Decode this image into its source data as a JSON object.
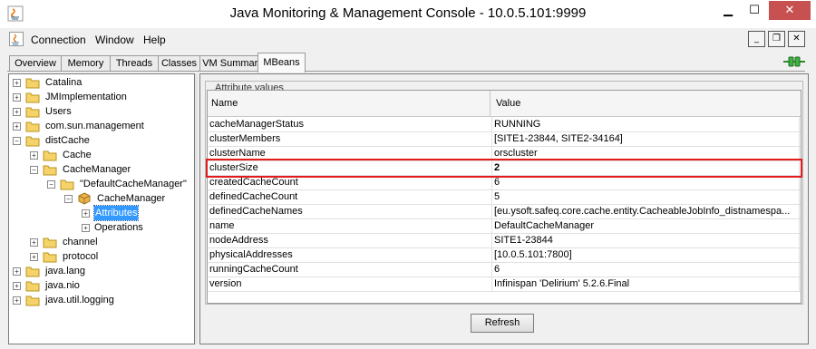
{
  "window": {
    "title": "Java Monitoring & Management Console - 10.0.5.101:9999"
  },
  "menubar": {
    "items": [
      "Connection",
      "Window",
      "Help"
    ]
  },
  "tabs": [
    "Overview",
    "Memory",
    "Threads",
    "Classes",
    "VM Summary",
    "MBeans"
  ],
  "active_tab": "MBeans",
  "tree": {
    "items": [
      {
        "label": "Catalina"
      },
      {
        "label": "JMImplementation"
      },
      {
        "label": "Users"
      },
      {
        "label": "com.sun.management"
      },
      {
        "label": "distCache"
      },
      {
        "label": "Cache"
      },
      {
        "label": "CacheManager"
      },
      {
        "label": "\"DefaultCacheManager\""
      },
      {
        "label": "CacheManager"
      },
      {
        "label": "Attributes"
      },
      {
        "label": "Operations"
      },
      {
        "label": "channel"
      },
      {
        "label": "protocol"
      },
      {
        "label": "java.lang"
      },
      {
        "label": "java.nio"
      },
      {
        "label": "java.util.logging"
      }
    ],
    "selected": "Attributes"
  },
  "attributes": {
    "group_title": "Attribute values",
    "columns": [
      "Name",
      "Value"
    ],
    "rows": [
      {
        "name": "cacheManagerStatus",
        "value": "RUNNING"
      },
      {
        "name": "clusterMembers",
        "value": "[SITE1-23844, SITE2-34164]"
      },
      {
        "name": "clusterName",
        "value": "orscluster"
      },
      {
        "name": "clusterSize",
        "value": "2"
      },
      {
        "name": "createdCacheCount",
        "value": "6"
      },
      {
        "name": "definedCacheCount",
        "value": "5"
      },
      {
        "name": "definedCacheNames",
        "value": "[eu.ysoft.safeq.core.cache.entity.CacheableJobInfo_distnamespa..."
      },
      {
        "name": "name",
        "value": "DefaultCacheManager"
      },
      {
        "name": "nodeAddress",
        "value": "SITE1-23844"
      },
      {
        "name": "physicalAddresses",
        "value": "[10.0.5.101:7800]"
      },
      {
        "name": "runningCacheCount",
        "value": "6"
      },
      {
        "name": "version",
        "value": "Infinispan 'Delirium' 5.2.6.Final"
      }
    ],
    "highlighted_row": "clusterSize"
  },
  "buttons": {
    "refresh": "Refresh"
  },
  "colors": {
    "highlight": "#e21c1c",
    "selection": "#3399ff",
    "close": "#c75050"
  }
}
